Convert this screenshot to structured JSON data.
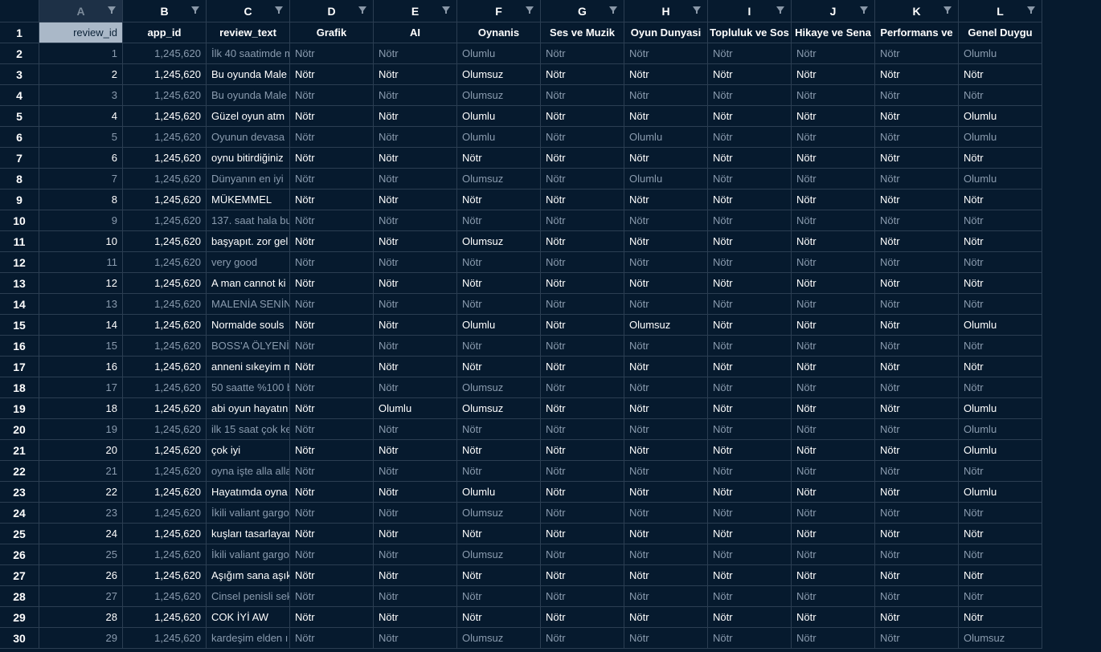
{
  "columns": [
    {
      "letter": "A",
      "header": "review_id"
    },
    {
      "letter": "B",
      "header": "app_id"
    },
    {
      "letter": "C",
      "header": "review_text"
    },
    {
      "letter": "D",
      "header": "Grafik"
    },
    {
      "letter": "E",
      "header": "AI"
    },
    {
      "letter": "F",
      "header": "Oynanis"
    },
    {
      "letter": "G",
      "header": "Ses ve Muzik"
    },
    {
      "letter": "H",
      "header": "Oyun Dunyasi"
    },
    {
      "letter": "I",
      "header": "Topluluk ve Sos"
    },
    {
      "letter": "J",
      "header": "Hikaye ve Sena"
    },
    {
      "letter": "K",
      "header": "Performans ve"
    },
    {
      "letter": "L",
      "header": "Genel Duygu"
    }
  ],
  "header_row_number": "1",
  "rows": [
    {
      "n": "2",
      "id": "1",
      "app": "1,245,620",
      "text": "İlk 40 saatimde m",
      "D": "Nötr",
      "E": "Nötr",
      "F": "Olumlu",
      "G": "Nötr",
      "H": "Nötr",
      "I": "Nötr",
      "J": "Nötr",
      "K": "Nötr",
      "L": "Olumlu"
    },
    {
      "n": "3",
      "id": "2",
      "app": "1,245,620",
      "text": "Bu oyunda Male",
      "D": "Nötr",
      "E": "Nötr",
      "F": "Olumsuz",
      "G": "Nötr",
      "H": "Nötr",
      "I": "Nötr",
      "J": "Nötr",
      "K": "Nötr",
      "L": "Nötr"
    },
    {
      "n": "4",
      "id": "3",
      "app": "1,245,620",
      "text": "Bu oyunda Male",
      "D": "Nötr",
      "E": "Nötr",
      "F": "Olumsuz",
      "G": "Nötr",
      "H": "Nötr",
      "I": "Nötr",
      "J": "Nötr",
      "K": "Nötr",
      "L": "Nötr"
    },
    {
      "n": "5",
      "id": "4",
      "app": "1,245,620",
      "text": "Güzel oyun  atm",
      "D": "Nötr",
      "E": "Nötr",
      "F": "Olumlu",
      "G": "Nötr",
      "H": "Nötr",
      "I": "Nötr",
      "J": "Nötr",
      "K": "Nötr",
      "L": "Olumlu"
    },
    {
      "n": "6",
      "id": "5",
      "app": "1,245,620",
      "text": "Oyunun devasa",
      "D": "Nötr",
      "E": "Nötr",
      "F": "Olumlu",
      "G": "Nötr",
      "H": "Olumlu",
      "I": "Nötr",
      "J": "Nötr",
      "K": "Nötr",
      "L": "Olumlu"
    },
    {
      "n": "7",
      "id": "6",
      "app": "1,245,620",
      "text": "oynu bitirdiğiniz",
      "D": "Nötr",
      "E": "Nötr",
      "F": "Nötr",
      "G": "Nötr",
      "H": "Nötr",
      "I": "Nötr",
      "J": "Nötr",
      "K": "Nötr",
      "L": "Nötr"
    },
    {
      "n": "8",
      "id": "7",
      "app": "1,245,620",
      "text": "Dünyanın en iyi",
      "D": "Nötr",
      "E": "Nötr",
      "F": "Olumsuz",
      "G": "Nötr",
      "H": "Olumlu",
      "I": "Nötr",
      "J": "Nötr",
      "K": "Nötr",
      "L": "Olumlu"
    },
    {
      "n": "9",
      "id": "8",
      "app": "1,245,620",
      "text": "MÜKEMMEL",
      "D": "Nötr",
      "E": "Nötr",
      "F": "Nötr",
      "G": "Nötr",
      "H": "Nötr",
      "I": "Nötr",
      "J": "Nötr",
      "K": "Nötr",
      "L": "Nötr"
    },
    {
      "n": "10",
      "id": "9",
      "app": "1,245,620",
      "text": "137. saat hala bu",
      "D": "Nötr",
      "E": "Nötr",
      "F": "Nötr",
      "G": "Nötr",
      "H": "Nötr",
      "I": "Nötr",
      "J": "Nötr",
      "K": "Nötr",
      "L": "Nötr"
    },
    {
      "n": "11",
      "id": "10",
      "app": "1,245,620",
      "text": "başyapıt. zor gel",
      "D": "Nötr",
      "E": "Nötr",
      "F": "Olumsuz",
      "G": "Nötr",
      "H": "Nötr",
      "I": "Nötr",
      "J": "Nötr",
      "K": "Nötr",
      "L": "Nötr"
    },
    {
      "n": "12",
      "id": "11",
      "app": "1,245,620",
      "text": "very good",
      "D": "Nötr",
      "E": "Nötr",
      "F": "Nötr",
      "G": "Nötr",
      "H": "Nötr",
      "I": "Nötr",
      "J": "Nötr",
      "K": "Nötr",
      "L": "Nötr"
    },
    {
      "n": "13",
      "id": "12",
      "app": "1,245,620",
      "text": "A man cannot ki",
      "D": "Nötr",
      "E": "Nötr",
      "F": "Nötr",
      "G": "Nötr",
      "H": "Nötr",
      "I": "Nötr",
      "J": "Nötr",
      "K": "Nötr",
      "L": "Nötr"
    },
    {
      "n": "14",
      "id": "13",
      "app": "1,245,620",
      "text": "MALENİA SENİN",
      "D": "Nötr",
      "E": "Nötr",
      "F": "Nötr",
      "G": "Nötr",
      "H": "Nötr",
      "I": "Nötr",
      "J": "Nötr",
      "K": "Nötr",
      "L": "Nötr"
    },
    {
      "n": "15",
      "id": "14",
      "app": "1,245,620",
      "text": "Normalde souls",
      "D": "Nötr",
      "E": "Nötr",
      "F": "Olumlu",
      "G": "Nötr",
      "H": "Olumsuz",
      "I": "Nötr",
      "J": "Nötr",
      "K": "Nötr",
      "L": "Olumlu"
    },
    {
      "n": "16",
      "id": "15",
      "app": "1,245,620",
      "text": "BOSS'A ÖLYENİ",
      "D": "Nötr",
      "E": "Nötr",
      "F": "Nötr",
      "G": "Nötr",
      "H": "Nötr",
      "I": "Nötr",
      "J": "Nötr",
      "K": "Nötr",
      "L": "Nötr"
    },
    {
      "n": "17",
      "id": "16",
      "app": "1,245,620",
      "text": "anneni sıkeyim m",
      "D": "Nötr",
      "E": "Nötr",
      "F": "Nötr",
      "G": "Nötr",
      "H": "Nötr",
      "I": "Nötr",
      "J": "Nötr",
      "K": "Nötr",
      "L": "Nötr"
    },
    {
      "n": "18",
      "id": "17",
      "app": "1,245,620",
      "text": "50 saatte %100 b",
      "D": "Nötr",
      "E": "Nötr",
      "F": "Olumsuz",
      "G": "Nötr",
      "H": "Nötr",
      "I": "Nötr",
      "J": "Nötr",
      "K": "Nötr",
      "L": "Nötr"
    },
    {
      "n": "19",
      "id": "18",
      "app": "1,245,620",
      "text": "abi oyun hayatın",
      "D": "Nötr",
      "E": "Olumlu",
      "F": "Olumsuz",
      "G": "Nötr",
      "H": "Nötr",
      "I": "Nötr",
      "J": "Nötr",
      "K": "Nötr",
      "L": "Olumlu"
    },
    {
      "n": "20",
      "id": "19",
      "app": "1,245,620",
      "text": "ilk 15 saat çok ke",
      "D": "Nötr",
      "E": "Nötr",
      "F": "Nötr",
      "G": "Nötr",
      "H": "Nötr",
      "I": "Nötr",
      "J": "Nötr",
      "K": "Nötr",
      "L": "Olumlu"
    },
    {
      "n": "21",
      "id": "20",
      "app": "1,245,620",
      "text": "çok iyi",
      "D": "Nötr",
      "E": "Nötr",
      "F": "Nötr",
      "G": "Nötr",
      "H": "Nötr",
      "I": "Nötr",
      "J": "Nötr",
      "K": "Nötr",
      "L": "Olumlu"
    },
    {
      "n": "22",
      "id": "21",
      "app": "1,245,620",
      "text": "oyna işte alla alla",
      "D": "Nötr",
      "E": "Nötr",
      "F": "Nötr",
      "G": "Nötr",
      "H": "Nötr",
      "I": "Nötr",
      "J": "Nötr",
      "K": "Nötr",
      "L": "Nötr"
    },
    {
      "n": "23",
      "id": "22",
      "app": "1,245,620",
      "text": "Hayatımda oyna",
      "D": "Nötr",
      "E": "Nötr",
      "F": "Olumlu",
      "G": "Nötr",
      "H": "Nötr",
      "I": "Nötr",
      "J": "Nötr",
      "K": "Nötr",
      "L": "Olumlu"
    },
    {
      "n": "24",
      "id": "23",
      "app": "1,245,620",
      "text": "İkili valiant gargo",
      "D": "Nötr",
      "E": "Nötr",
      "F": "Olumsuz",
      "G": "Nötr",
      "H": "Nötr",
      "I": "Nötr",
      "J": "Nötr",
      "K": "Nötr",
      "L": "Nötr"
    },
    {
      "n": "25",
      "id": "24",
      "app": "1,245,620",
      "text": "kuşları tasarlayan",
      "D": "Nötr",
      "E": "Nötr",
      "F": "Nötr",
      "G": "Nötr",
      "H": "Nötr",
      "I": "Nötr",
      "J": "Nötr",
      "K": "Nötr",
      "L": "Nötr"
    },
    {
      "n": "26",
      "id": "25",
      "app": "1,245,620",
      "text": "İkili valiant gargo",
      "D": "Nötr",
      "E": "Nötr",
      "F": "Olumsuz",
      "G": "Nötr",
      "H": "Nötr",
      "I": "Nötr",
      "J": "Nötr",
      "K": "Nötr",
      "L": "Nötr"
    },
    {
      "n": "27",
      "id": "26",
      "app": "1,245,620",
      "text": "Aşığım sana aşık",
      "D": "Nötr",
      "E": "Nötr",
      "F": "Nötr",
      "G": "Nötr",
      "H": "Nötr",
      "I": "Nötr",
      "J": "Nötr",
      "K": "Nötr",
      "L": "Nötr"
    },
    {
      "n": "28",
      "id": "27",
      "app": "1,245,620",
      "text": "Cinsel penisli sek",
      "D": "Nötr",
      "E": "Nötr",
      "F": "Nötr",
      "G": "Nötr",
      "H": "Nötr",
      "I": "Nötr",
      "J": "Nötr",
      "K": "Nötr",
      "L": "Nötr"
    },
    {
      "n": "29",
      "id": "28",
      "app": "1,245,620",
      "text": "COK İYİ AW",
      "D": "Nötr",
      "E": "Nötr",
      "F": "Nötr",
      "G": "Nötr",
      "H": "Nötr",
      "I": "Nötr",
      "J": "Nötr",
      "K": "Nötr",
      "L": "Nötr"
    },
    {
      "n": "30",
      "id": "29",
      "app": "1,245,620",
      "text": "kardeşim elden ı",
      "D": "Nötr",
      "E": "Nötr",
      "F": "Olumsuz",
      "G": "Nötr",
      "H": "Nötr",
      "I": "Nötr",
      "J": "Nötr",
      "K": "Nötr",
      "L": "Olumsuz"
    }
  ],
  "colors": {
    "background": "#061a2e",
    "grid": "#2b3e52",
    "dim_text": "#8a9bae",
    "selected_cell": "#aab8c8"
  },
  "icons": {
    "filter": "filter-icon"
  }
}
